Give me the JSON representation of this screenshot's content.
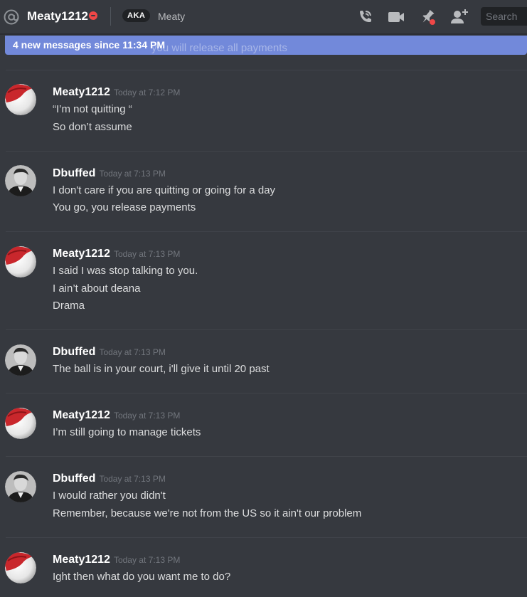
{
  "header": {
    "channel_name": "Meaty1212",
    "aka_label": "AKA",
    "aka_name": "Meaty",
    "search_placeholder": "Search"
  },
  "new_messages_bar": {
    "text": "4 new messages since 11:34 PM",
    "ghost_text": "you will release all payments"
  },
  "colors": {
    "background": "#36393f",
    "accent": "#7289da",
    "dnd_status": "#f04747",
    "pin_badge": "#f04747"
  },
  "messages": [
    {
      "author": "Meaty1212",
      "timestamp": "Today at 7:12 PM",
      "avatar": "red-santa-hat-avatar",
      "lines": [
        "“I’m not quitting “",
        "So don’t assume"
      ]
    },
    {
      "author": "Dbuffed",
      "timestamp": "Today at 7:13 PM",
      "avatar": "portrait-avatar",
      "lines": [
        "I don't care if you are quitting or going for a day",
        "You go, you release payments"
      ]
    },
    {
      "author": "Meaty1212",
      "timestamp": "Today at 7:13 PM",
      "avatar": "red-santa-hat-avatar",
      "lines": [
        "I said I was stop talking to you.",
        "I ain’t about deana",
        "Drama"
      ]
    },
    {
      "author": "Dbuffed",
      "timestamp": "Today at 7:13 PM",
      "avatar": "portrait-avatar",
      "lines": [
        "The ball is in your court, i'll give it until 20 past"
      ]
    },
    {
      "author": "Meaty1212",
      "timestamp": "Today at 7:13 PM",
      "avatar": "red-santa-hat-avatar",
      "lines": [
        "I’m still going to manage tickets"
      ]
    },
    {
      "author": "Dbuffed",
      "timestamp": "Today at 7:13 PM",
      "avatar": "portrait-avatar",
      "lines": [
        "I would rather you didn't",
        "Remember, because we're not from the US so it ain't our problem"
      ]
    },
    {
      "author": "Meaty1212",
      "timestamp": "Today at 7:13 PM",
      "avatar": "red-santa-hat-avatar",
      "lines": [
        "Ight then what do you want me to do?"
      ]
    }
  ]
}
